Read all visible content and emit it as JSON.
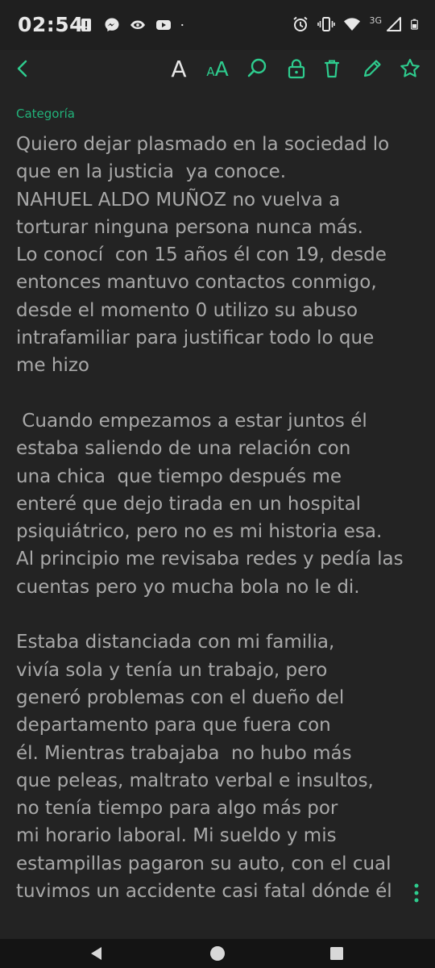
{
  "status_bar": {
    "time": "02:54",
    "network_label": "3G",
    "icons_left": [
      "alert-icon",
      "messenger-icon",
      "eye-icon",
      "youtube-icon",
      "dot-icon"
    ],
    "icons_right": [
      "alarm-icon",
      "vibrate-icon",
      "wifi-icon",
      "signal-icon",
      "battery-icon"
    ]
  },
  "toolbar": {
    "font_label": "A",
    "font_size_small": "A",
    "font_size_big": "A",
    "accent_color": "#2ecc8e",
    "icons": [
      "back-icon",
      "font-icon",
      "font-size-icon",
      "search-icon",
      "lock-icon",
      "trash-icon",
      "edit-icon",
      "star-icon"
    ]
  },
  "note": {
    "category": "Categoría",
    "lines": [
      "Quiero dejar plasmado en la sociedad lo",
      "que en la justicia  ya conoce.",
      "NAHUEL ALDO MUÑOZ no vuelva a",
      "torturar ninguna persona nunca más.",
      "Lo conocí  con 15 años él con 19, desde",
      "entonces mantuvo contactos conmigo,",
      "desde el momento 0 utilizo su abuso",
      "intrafamiliar para justificar todo lo que",
      "me hizo",
      "",
      " Cuando empezamos a estar juntos él",
      "estaba saliendo de una relación con",
      "una chica  que tiempo después me",
      "enteré que dejo tirada en un hospital",
      "psiquiátrico, pero no es mi historia esa.",
      "Al principio me revisaba redes y pedía las",
      "cuentas pero yo mucha bola no le di.",
      "",
      "Estaba distanciada con mi familia,",
      "vivía sola y tenía un trabajo, pero",
      "generó problemas con el dueño del",
      "departamento para que fuera con",
      "él. Mientras trabajaba  no hubo más",
      "que peleas, maltrato verbal e insultos,",
      "no tenía tiempo para algo más por",
      "mi horario laboral. Mi sueldo y mis",
      "estampillas pagaron su auto, con el cual",
      "tuvimos un accidente casi fatal dónde él"
    ]
  },
  "nav_bar": {
    "icons": [
      "nav-back-icon",
      "nav-home-icon",
      "nav-recents-icon"
    ]
  }
}
